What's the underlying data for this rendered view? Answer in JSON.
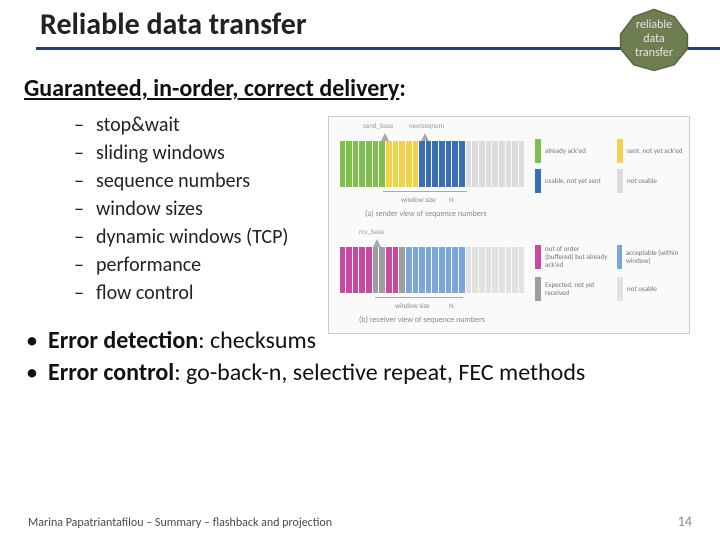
{
  "title": "Reliable data transfer",
  "badge": {
    "line1": "reliable",
    "line2": "data",
    "line3": "transfer"
  },
  "subhead": {
    "text": "Guaranteed, in-order, correct delivery",
    "suffix": ":"
  },
  "dash_items": [
    "stop&wait",
    "sliding windows",
    "sequence  numbers",
    "window sizes",
    "dynamic windows (TCP)",
    "performance",
    "flow control"
  ],
  "bullets": [
    {
      "strong": "Error detection",
      "rest": ": checksums"
    },
    {
      "strong": "Error control",
      "rest": ": go-back-n, selective repeat, FEC methods"
    }
  ],
  "figure": {
    "top_labels": {
      "left": "send_base",
      "right": "nextseqnum"
    },
    "legend_top": [
      {
        "color": "#7fbf4f",
        "label": "already ack'ed"
      },
      {
        "color": "#f2d24a",
        "label": "sent, not yet ack'ed"
      },
      {
        "color": "#3b6fb5",
        "label": "usable, not yet sent"
      },
      {
        "color": "#dcdcdc",
        "label": "not usable"
      }
    ],
    "caption_top": "(a) sender view of sequence numbers",
    "window_label_top": "window size",
    "bot_labels": {
      "left": "rcv_base"
    },
    "legend_bot": [
      {
        "color": "#c74aa0",
        "label": "out of order (buffered) but already ack'ed"
      },
      {
        "color": "#7aa6d9",
        "label": "acceptable (within window)"
      },
      {
        "color": "#9e9e9e",
        "label": "Expected, not yet received"
      },
      {
        "color": "#e2e2e2",
        "label": "not usable"
      }
    ],
    "caption_bot": "(b) receiver view of sequence numbers",
    "window_label_bot": "window size",
    "n_label": "N",
    "top_bars": [
      "#7fbf4f",
      "#7fbf4f",
      "#7fbf4f",
      "#7fbf4f",
      "#7fbf4f",
      "#7fbf4f",
      "#7fbf4f",
      "#f2d24a",
      "#f2d24a",
      "#f2d24a",
      "#f2d24a",
      "#f2d24a",
      "#3b6fb5",
      "#3b6fb5",
      "#3b6fb5",
      "#3b6fb5",
      "#3b6fb5",
      "#3b6fb5",
      "#3b6fb5",
      "#dcdcdc",
      "#dcdcdc",
      "#dcdcdc",
      "#dcdcdc",
      "#dcdcdc",
      "#dcdcdc",
      "#dcdcdc",
      "#dcdcdc",
      "#dcdcdc"
    ],
    "bot_bars": [
      "#c74aa0",
      "#c74aa0",
      "#c74aa0",
      "#c74aa0",
      "#c74aa0",
      "#9e9e9e",
      "#9e9e9e",
      "#c74aa0",
      "#c74aa0",
      "#9e9e9e",
      "#7aa6d9",
      "#7aa6d9",
      "#7aa6d9",
      "#7aa6d9",
      "#7aa6d9",
      "#7aa6d9",
      "#7aa6d9",
      "#7aa6d9",
      "#7aa6d9",
      "#e2e2e2",
      "#e2e2e2",
      "#e2e2e2",
      "#e2e2e2",
      "#e2e2e2",
      "#e2e2e2",
      "#e2e2e2",
      "#e2e2e2",
      "#e2e2e2"
    ]
  },
  "footer": {
    "left": "Marina Papatriantafilou – Summary – flashback and projection",
    "page": "14"
  }
}
